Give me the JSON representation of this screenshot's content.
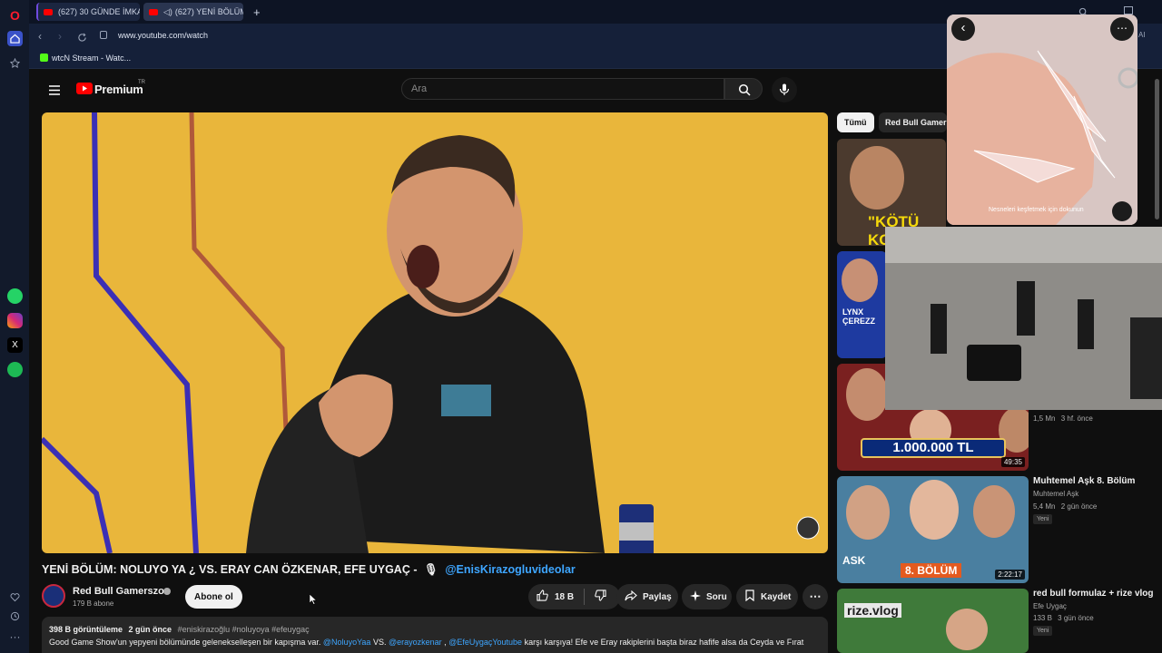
{
  "browser": {
    "tabs": [
      {
        "label": "(627) 30 GÜNDE İMKANS"
      },
      {
        "label": "(627) YENİ BÖLÜM: N"
      }
    ],
    "new_tab_symbol": "+",
    "url": "www.youtube.com/watch",
    "bookmark": "wtcN Stream - Watc...",
    "ai_label": "AI"
  },
  "sidebar": {
    "opera_logo": "O",
    "apps": [
      "whatsapp-icon",
      "instagram-icon",
      "x-icon",
      "spotify-icon"
    ],
    "more": "···"
  },
  "youtube": {
    "logo_text": "Premium",
    "logo_sup": "TR",
    "search_placeholder": "Ara",
    "video": {
      "title": "YENİ BÖLÜM: NOLUYO YA ¿ VS. ERAY CAN ÖZKENAR, EFE UYGAÇ -",
      "title_link": "@EnisKirazogluvideolar",
      "channel_name": "Red Bull Gamerszon",
      "subscribers": "179 B abone",
      "subscribe_label": "Abone ol",
      "likes": "18 B",
      "share_label": "Paylaş",
      "ask_label": "Soru",
      "save_label": "Kaydet",
      "views": "398 B görüntüleme",
      "age": "2 gün önce",
      "hashtags": "#eniskirazoğlu #noluyoya #efeuygaç",
      "desc_start": "Good Game Show'un yepyeni bölümünde gelenekselleşen bir kapışma var.",
      "desc_mention1": "@NoluyoYaa",
      "desc_vs": "VS.",
      "desc_mention2": "@erayozkenar",
      "desc_mention3": "@EfeUygaçYoutube",
      "desc_end": "karşı karşıya! Efe ve Eray rakiplerini başta biraz hafife alsa da Ceyda ve Fırat"
    },
    "chips": [
      "Tümü",
      "Red Bull Gamer"
    ],
    "recommendations": [
      {
        "thumb_text": "\"KÖTÜ KO"
      },
      {
        "thumb_text": "LYNX ÇEREZZ"
      },
      {
        "meta_views": "1,5 Mn",
        "meta_age": "3 hf. önce",
        "thumb_text": "1.000.000 TL",
        "duration": "49:35"
      },
      {
        "title": "Muhtemel Aşk 8. Bölüm",
        "channel": "Muhtemel Aşk",
        "meta_views": "5,4 Mn",
        "meta_age": "2 gün önce",
        "badge": "Yeni",
        "thumb_text": "8. BÖLÜM",
        "brand": "ASK",
        "duration": "2:22:17"
      },
      {
        "title": "red bull formulaz + rize vlog",
        "channel": "Efe Uygaç",
        "meta_views": "133 B",
        "meta_age": "3 gün önce",
        "badge": "Yeni",
        "thumb_text": "rize.vlog"
      }
    ],
    "popup_caption": "Nesneleri keşfetmek için dokunun"
  },
  "colors": {
    "yt_red": "#ff0000",
    "link_blue": "#3ea6ff",
    "player_bg": "#e9b63b"
  }
}
